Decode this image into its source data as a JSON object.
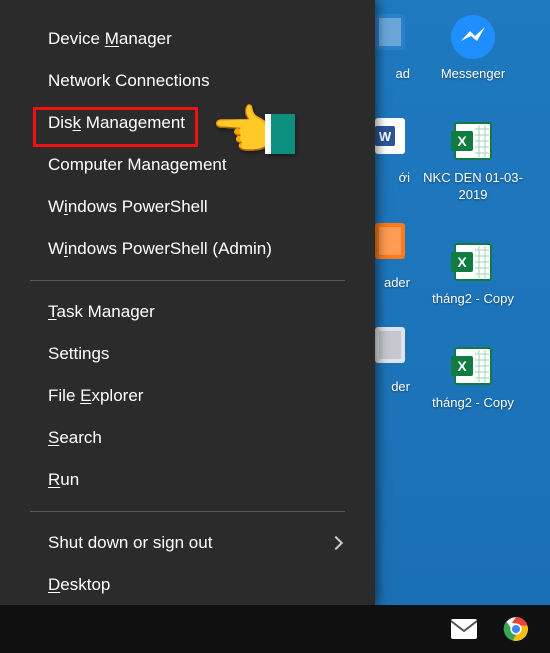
{
  "menu": {
    "group1": [
      {
        "label": "Device Manager",
        "ul": "M"
      },
      {
        "label": "Network Connections",
        "ul": ""
      },
      {
        "label": "Disk Management",
        "ul": "k",
        "highlighted": true
      },
      {
        "label": "Computer Management",
        "ul": ""
      },
      {
        "label": "Windows PowerShell",
        "ul": "i"
      },
      {
        "label": "Windows PowerShell (Admin)",
        "ul": "i"
      }
    ],
    "group2": [
      {
        "label": "Task Manager",
        "ul": "T"
      },
      {
        "label": "Settings",
        "ul": ""
      },
      {
        "label": "File Explorer",
        "ul": "E"
      },
      {
        "label": "Search",
        "ul": "S"
      },
      {
        "label": "Run",
        "ul": "R"
      }
    ],
    "group3": [
      {
        "label": "Shut down or sign out",
        "ul": "U",
        "submenu": true
      },
      {
        "label": "Desktop",
        "ul": "D"
      }
    ]
  },
  "desktop_icons_right": [
    {
      "name": "messenger",
      "label": "Messenger"
    },
    {
      "name": "excel",
      "label": "NKC DEN 01-03-2019"
    },
    {
      "name": "excel",
      "label": "tháng2 - Copy"
    },
    {
      "name": "excel",
      "label": "tháng2 - Copy"
    }
  ],
  "desktop_icons_partial": [
    {
      "name": "generic",
      "label": "ad"
    },
    {
      "name": "word",
      "label": "ới"
    },
    {
      "name": "pdf",
      "label": "ader"
    },
    {
      "name": "generic",
      "label": "der"
    }
  ],
  "taskbar": {
    "items": [
      "mail-icon",
      "chrome-icon"
    ]
  },
  "colors": {
    "menu_bg": "#2b2b2b",
    "desktop_bg": "#1a6fb4",
    "highlight": "#e11",
    "accent_cuff": "#0d8f80"
  }
}
